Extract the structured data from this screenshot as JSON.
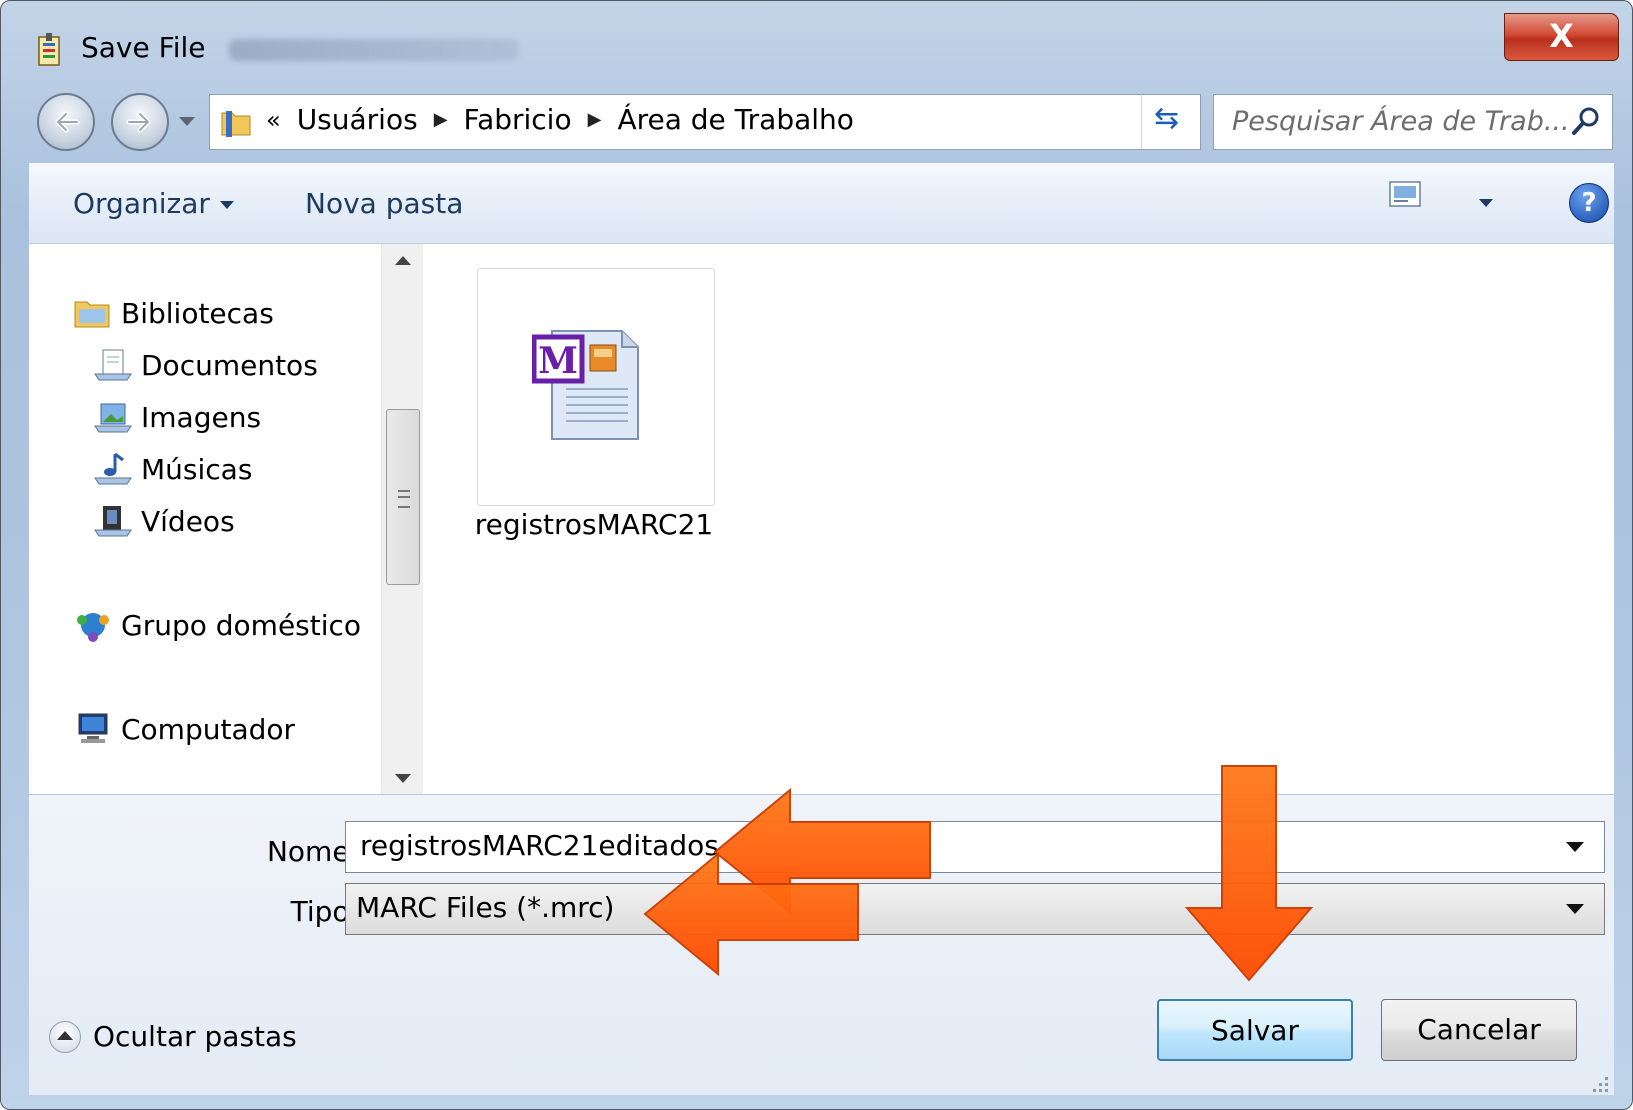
{
  "window": {
    "title": "Save File",
    "close_glyph": "X"
  },
  "nav": {
    "back_icon": "back-arrow-icon",
    "forward_icon": "forward-arrow-icon"
  },
  "address": {
    "prefix": "«",
    "crumbs": [
      "Usuários",
      "Fabricio",
      "Área de Trabalho"
    ]
  },
  "search": {
    "placeholder": "Pesquisar Área de Trab..."
  },
  "toolbar": {
    "organize": "Organizar",
    "new_folder": "Nova pasta",
    "help": "?"
  },
  "sidebar": {
    "items": [
      {
        "label": "Bibliotecas",
        "icon": "libraries-icon"
      },
      {
        "label": "Documentos",
        "icon": "documents-icon"
      },
      {
        "label": "Imagens",
        "icon": "pictures-icon"
      },
      {
        "label": "Músicas",
        "icon": "music-icon"
      },
      {
        "label": "Vídeos",
        "icon": "videos-icon"
      },
      {
        "label": "Grupo doméstico",
        "icon": "homegroup-icon"
      },
      {
        "label": "Computador",
        "icon": "computer-icon"
      }
    ]
  },
  "files": [
    {
      "name": "registrosMARC21",
      "icon": "marc-file-icon"
    }
  ],
  "form": {
    "name_label": "Nome:",
    "name_value": "registrosMARC21editados",
    "type_label": "Tipo:",
    "type_value": "MARC Files (*.mrc)"
  },
  "footer": {
    "hide_folders": "Ocultar pastas"
  },
  "buttons": {
    "save": "Salvar",
    "cancel": "Cancelar"
  },
  "colors": {
    "annotation_arrow": "#ff5a00",
    "accent": "#1e3a5f"
  }
}
